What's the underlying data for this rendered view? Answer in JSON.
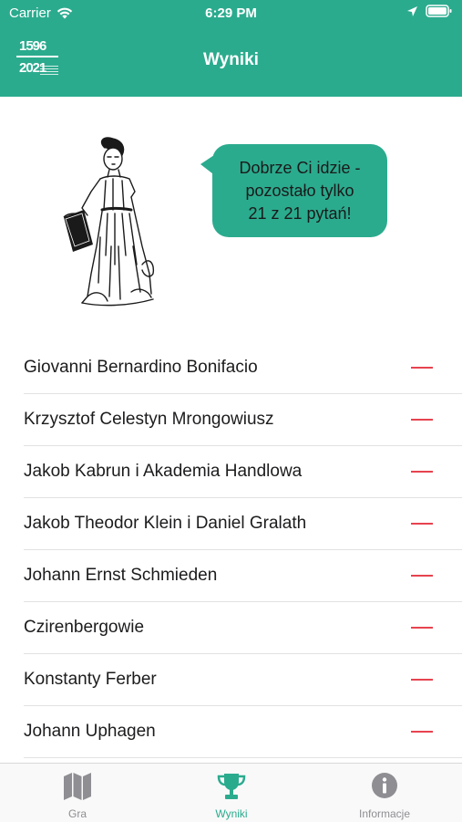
{
  "status_bar": {
    "carrier": "Carrier",
    "time": "6:29 PM"
  },
  "header": {
    "title": "Wyniki",
    "logo": {
      "year_top": "1596",
      "year_bottom": "2021"
    }
  },
  "speech_bubble": {
    "lines": [
      "Dobrze Ci idzie -",
      "pozostało tylko",
      "21 z 21 pytań!"
    ]
  },
  "results": [
    {
      "name": "Giovanni Bernardino Bonifacio",
      "status": "—"
    },
    {
      "name": "Krzysztof Celestyn Mrongowiusz",
      "status": "—"
    },
    {
      "name": "Jakob Kabrun i Akademia Handlowa",
      "status": "—"
    },
    {
      "name": "Jakob Theodor Klein i Daniel Gralath",
      "status": "—"
    },
    {
      "name": "Johann Ernst Schmieden",
      "status": "—"
    },
    {
      "name": "Czirenbergowie",
      "status": "—"
    },
    {
      "name": "Konstanty Ferber",
      "status": "—"
    },
    {
      "name": "Johann Uphagen",
      "status": "—"
    }
  ],
  "tab_bar": {
    "tabs": [
      {
        "label": "Gra",
        "icon": "map-icon",
        "active": false
      },
      {
        "label": "Wyniki",
        "icon": "trophy-icon",
        "active": true
      },
      {
        "label": "Informacje",
        "icon": "info-icon",
        "active": false
      }
    ]
  },
  "colors": {
    "accent": "#2bab8e",
    "dash": "#e8434f",
    "inactive": "#8e8e93"
  }
}
